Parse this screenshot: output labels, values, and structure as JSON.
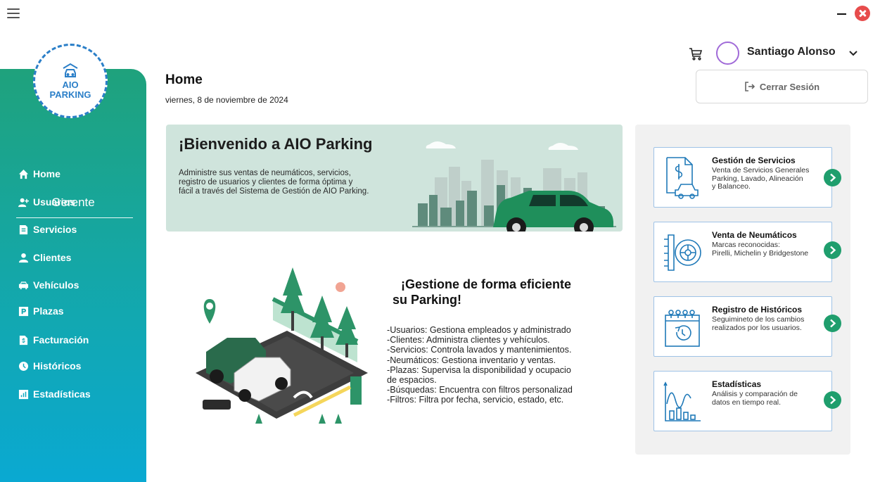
{
  "window": {
    "menu_icon": "hamburger-icon",
    "minimize_icon": "minimize-icon",
    "close_icon": "close-icon"
  },
  "sidebar": {
    "logo_line1": "AIO",
    "logo_line2": "PARKING",
    "role": "Gerente",
    "items": [
      {
        "label": "Home",
        "icon": "home-icon"
      },
      {
        "label": "Usuarios",
        "icon": "add-user-icon"
      },
      {
        "label": "Servicios",
        "icon": "services-icon"
      },
      {
        "label": "Clientes",
        "icon": "clients-icon"
      },
      {
        "label": "Vehículos",
        "icon": "car-icon"
      },
      {
        "label": "Plazas",
        "icon": "parking-icon"
      },
      {
        "label": "Facturación",
        "icon": "invoice-icon"
      },
      {
        "label": "Históricos",
        "icon": "history-icon"
      },
      {
        "label": "Estadísticas",
        "icon": "stats-icon"
      }
    ]
  },
  "header": {
    "title": "Home",
    "date": "viernes, 8 de noviembre de 2024",
    "user_name": "Santiago Alonso",
    "logout_label": "Cerrar Sesión"
  },
  "banner": {
    "title": "¡Bienvenido a AIO Parking",
    "text_lines": [
      "Administre sus ventas de neumáticos, servicios,",
      "registro de usuarios y clientes de forma óptima y",
      "fácil a través del Sistema de Gestión de AIO Parking."
    ]
  },
  "feature": {
    "title_line1": "¡Gestione de forma eficiente",
    "title_line2": "su Parking!",
    "lines": [
      "-Usuarios: Gestiona empleados y administrado",
      "-Clientes: Administra clientes y vehículos.",
      "-Servicios: Controla lavados y mantenimientos.",
      "-Neumáticos: Gestiona inventario y ventas.",
      "-Plazas: Supervisa la disponibilidad y ocupacio",
      "de espacios.",
      "-Búsquedas: Encuentra con filtros personalizad",
      "-Filtros: Filtra por fecha, servicio, estado, etc."
    ]
  },
  "cards": [
    {
      "title": "Gestión de Servicios",
      "icon": "service-document-icon",
      "desc": [
        "Venta de Servicios Generales",
        "Parking, Lavado, Alineación",
        "y Balanceo."
      ]
    },
    {
      "title": "Venta de Neumáticos",
      "icon": "tire-icon",
      "desc": [
        "Marcas reconocidas:",
        "Pirelli, Michelin y Bridgestone"
      ]
    },
    {
      "title": "Registro de Históricos",
      "icon": "calendar-history-icon",
      "desc": [
        "Seguimineto de los cambios",
        "realizados por los usuarios."
      ]
    },
    {
      "title": "Estadísticas",
      "icon": "chart-icon",
      "desc": [
        "Análisis y comparación de",
        "datos en tiempo real."
      ]
    }
  ],
  "colors": {
    "sidebar_top": "#1fa27c",
    "sidebar_bottom": "#0aa9d2",
    "accent_green": "#1f9e6d",
    "banner_bg": "#cfe4dc",
    "card_border": "#9ec2e6",
    "logo_blue": "#2b7fc8"
  }
}
